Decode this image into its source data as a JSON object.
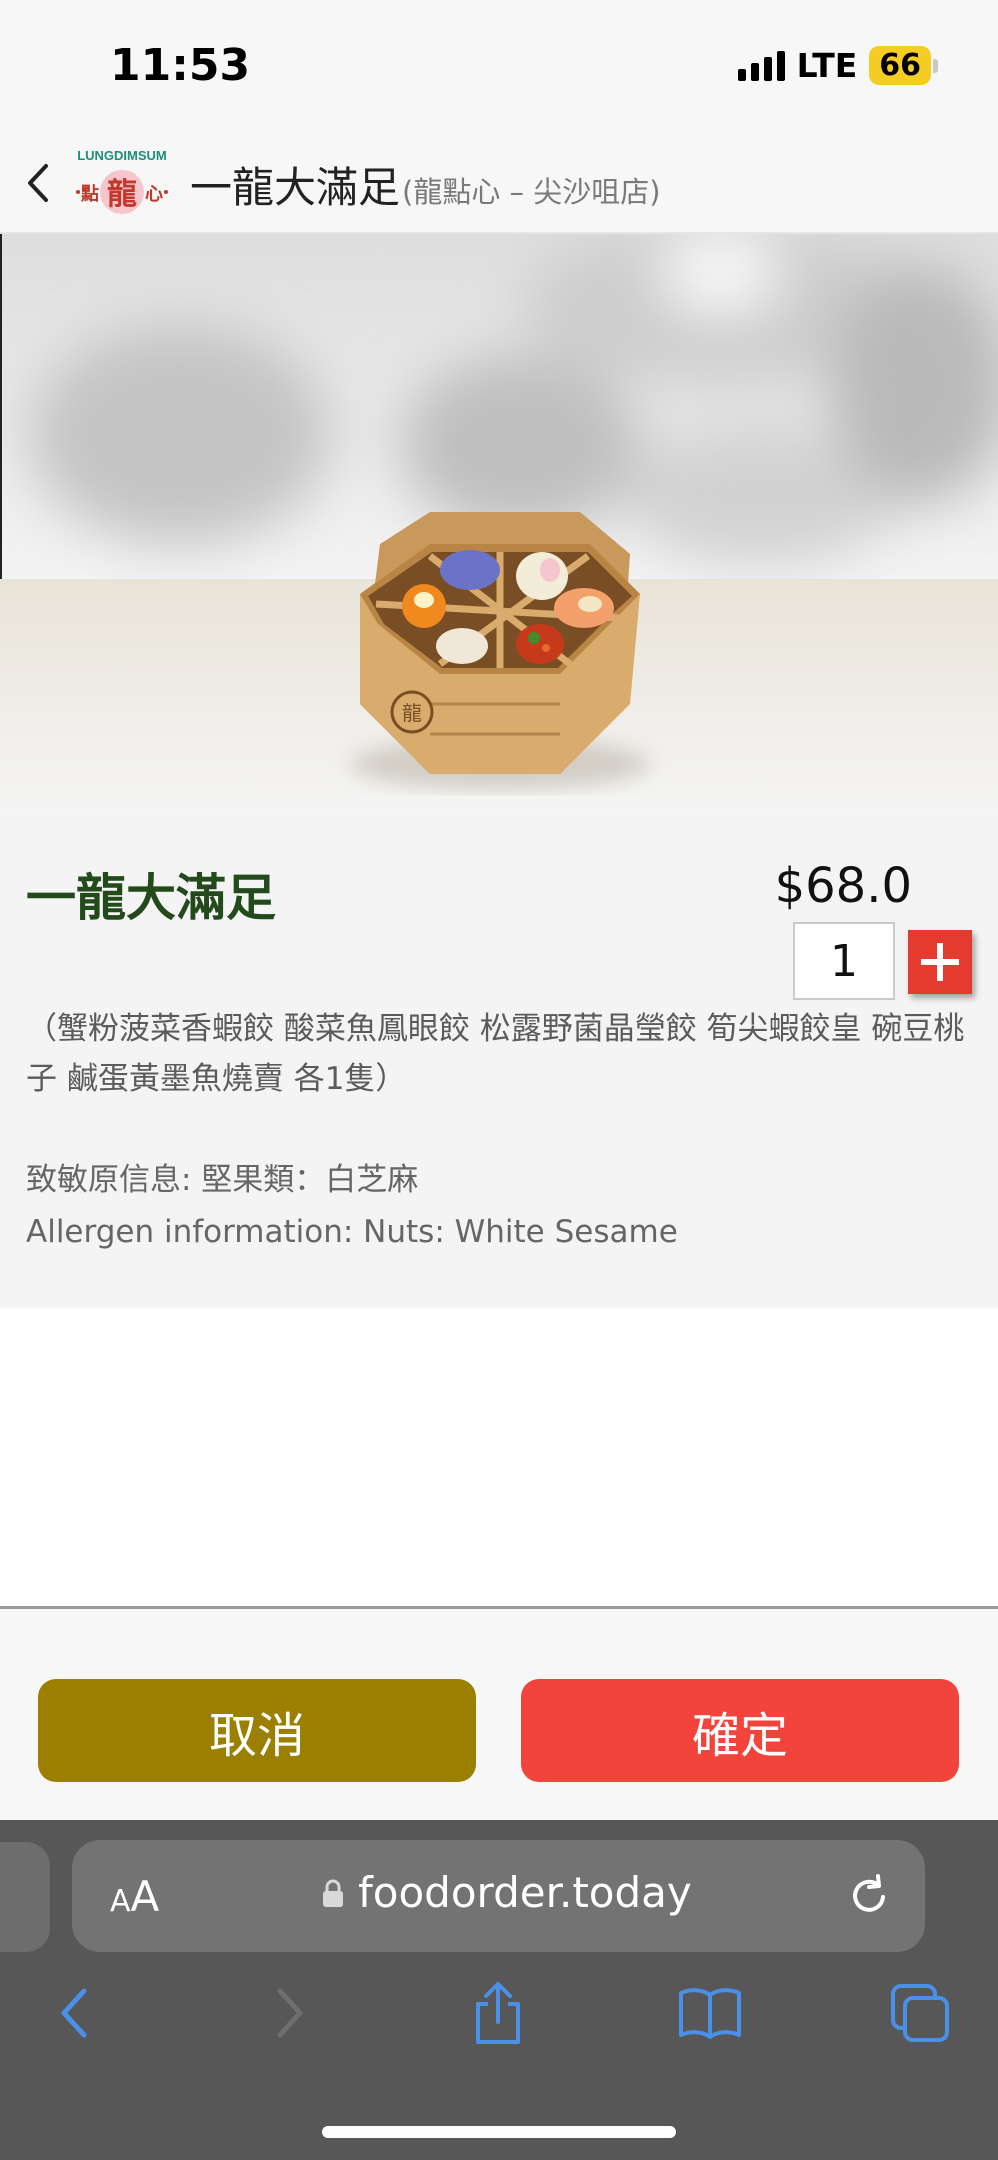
{
  "status_bar": {
    "time": "11:53",
    "network": "LTE",
    "battery": "66",
    "battery_color": "#f4cd24"
  },
  "header": {
    "back_icon": "chevron-left-icon",
    "logo_text_top": "LUNGDIMSUM",
    "logo_glyphs": "點龍心",
    "title": "一龍大滿足",
    "subtitle": "(龍點心 – 尖沙咀店)"
  },
  "product": {
    "name": "一龍大滿足",
    "price": "$68.0",
    "quantity": "1",
    "add_icon": "plus-icon",
    "description": "（蟹粉菠菜香蝦餃 酸菜魚鳳眼餃 松露野菌晶瑩餃 筍尖蝦餃皇 碗豆桃子 鹹蛋黃墨魚燒賣 各1隻）",
    "allergen_zh": "致敏原信息: 堅果類：白芝麻",
    "allergen_en": "Allergen information: Nuts: White Sesame",
    "name_color": "#234a1b"
  },
  "actions": {
    "cancel_label": "取消",
    "confirm_label": "確定",
    "cancel_color": "#9a7f00",
    "confirm_color": "#f2443a"
  },
  "browser": {
    "text_size_small": "A",
    "text_size_big": "A",
    "url": "foodorder.today",
    "lock_icon": "lock-icon",
    "reload_icon": "reload-icon",
    "nav_icons": [
      "back-arrow-icon",
      "forward-arrow-icon",
      "share-icon",
      "bookmarks-icon",
      "tabs-icon"
    ],
    "accent_color": "#4a90e8"
  }
}
